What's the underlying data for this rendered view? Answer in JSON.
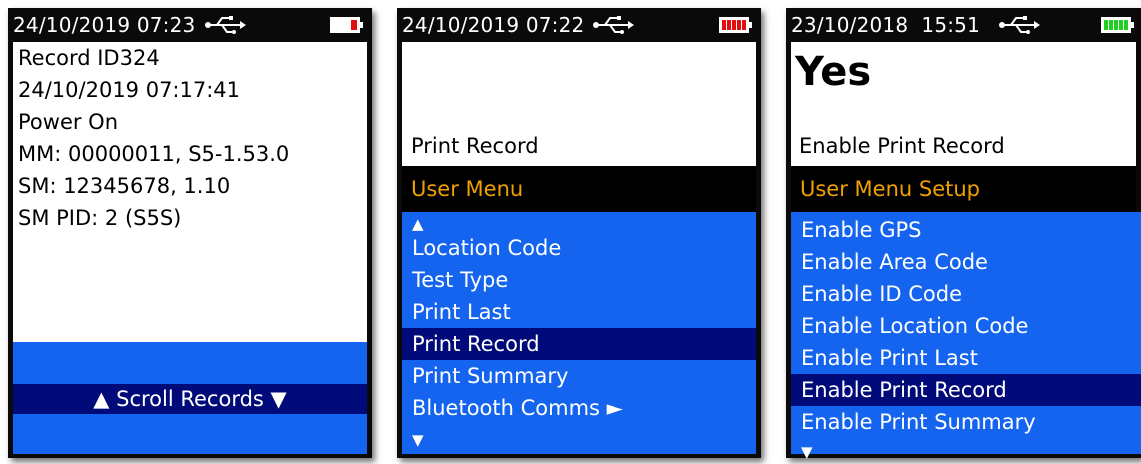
{
  "screen1": {
    "status": {
      "datetime": "24/10/2019 07:23",
      "battery_color": "#e01010",
      "battery_level": 0.25
    },
    "record_lines": [
      "Record ID324",
      "24/10/2019 07:17:41",
      "Power On",
      "MM: 00000011, S5-1.53.0",
      "SM: 12345678, 1.10",
      "SM PID: 2 (S5S)"
    ],
    "footer_label": "▲ Scroll Records ▼"
  },
  "screen2": {
    "status": {
      "datetime": "24/10/2019 07:22",
      "battery_color": "#e01010",
      "battery_level": 1.0
    },
    "selected_title": "Print Record",
    "menu_title": "User Menu",
    "up_arrow": "▲",
    "items": [
      "Location Code",
      "Test Type",
      "Print Last",
      "Print Record",
      "Print Summary",
      "Bluetooth Comms ►"
    ],
    "selected_index": 3,
    "down_arrow": "▼"
  },
  "screen3": {
    "status": {
      "datetime": "23/10/2018  15:51",
      "battery_color": "#20d020",
      "battery_level": 1.0
    },
    "value": "Yes",
    "selected_title": "Enable Print Record",
    "menu_title": "User Menu Setup",
    "items": [
      "Enable GPS",
      "Enable Area Code",
      "Enable ID Code",
      "Enable Location Code",
      "Enable Print Last",
      "Enable Print Record",
      "Enable Print Summary"
    ],
    "selected_index": 5,
    "down_arrow": "▼"
  },
  "colors": {
    "menu_blue": "#1464f0",
    "selection": "#000a78",
    "header_text": "#f0a000",
    "usb_icon": "#ffffff"
  }
}
